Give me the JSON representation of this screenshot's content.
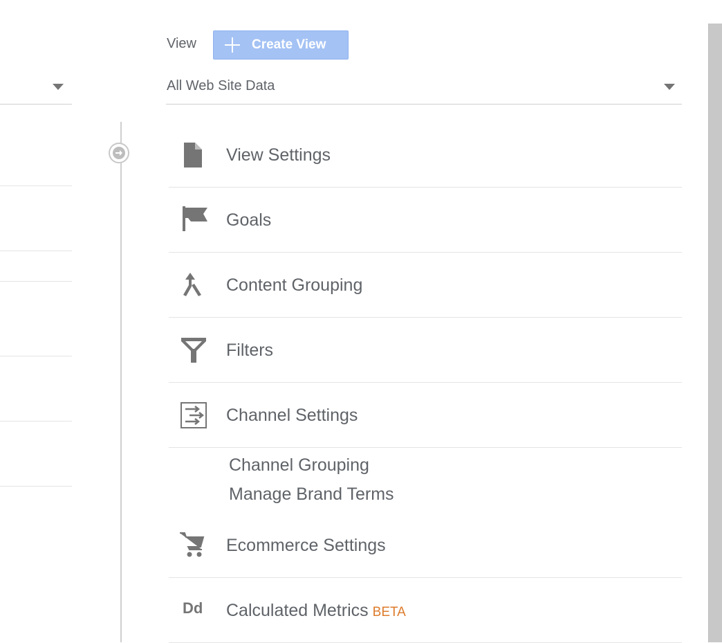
{
  "view": {
    "label": "View",
    "create_button": "Create View",
    "selected": "All Web Site Data"
  },
  "menu": {
    "view_settings": "View Settings",
    "goals": "Goals",
    "content_grouping": "Content Grouping",
    "filters": "Filters",
    "channel_settings": "Channel Settings",
    "channel_grouping": "Channel Grouping",
    "manage_brand_terms": "Manage Brand Terms",
    "ecommerce_settings": "Ecommerce Settings",
    "calculated_metrics": "Calculated Metrics",
    "beta_badge": "BETA"
  },
  "icons": {
    "view_settings": "document-icon",
    "goals": "flag-icon",
    "content_grouping": "merge-icon",
    "filters": "filter-icon",
    "channel_settings": "channel-settings-icon",
    "ecommerce_settings": "cart-icon",
    "calculated_metrics": "dd-icon"
  },
  "colors": {
    "accent_button": "#a4c2f4",
    "text": "#5f6368",
    "icon": "#757575",
    "beta": "#dd7b2a"
  }
}
